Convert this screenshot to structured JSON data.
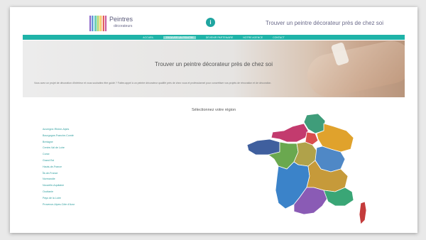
{
  "header": {
    "logo_title": "Peintres",
    "logo_subtitle": "décorateurs",
    "info_label": "i",
    "tagline": "Trouver un peintre décorateur près de chez soi",
    "logo_colors": [
      "#8a63c7",
      "#5c8fd6",
      "#3fb4c6",
      "#4ec59a",
      "#a3cf5b",
      "#f0c84b",
      "#f19a45",
      "#e2575b",
      "#c8589f"
    ]
  },
  "nav": {
    "items": [
      "Accueil",
      "Trouver un peintre",
      "Devenir partenaire",
      "Notre agence",
      "Contact"
    ],
    "active_index": 1,
    "accent": "#1fb3a8"
  },
  "hero": {
    "title": "Trouver un peintre décorateur près de chez soi",
    "text": "Vous avez un projet de décoration d'intérieur et vous souhaitez être guidé ? Faites appel à un peintre décorateur qualifié près de chez vous et professionnel pour concrétiser vos projets de rénovation et de décoration."
  },
  "regions_section": {
    "title": "Sélectionnez votre région",
    "items": [
      "Auvergne-Rhône-Alpes",
      "Bourgogne-Franche-Comté",
      "Bretagne",
      "Centre-Val de Loire",
      "Corse",
      "Grand Est",
      "Hauts-de-France",
      "Île-de-France",
      "Normandie",
      "Nouvelle-Aquitaine",
      "Occitanie",
      "Pays de la Loire",
      "Provence-Alpes-Côte d'Azur"
    ]
  },
  "map": {
    "colors": {
      "hauts_de_france": "#3f9d7a",
      "normandie": "#c33b6e",
      "ile_de_france": "#d94e4e",
      "grand_est": "#e0a22c",
      "bretagne": "#3f5f9e",
      "pays_de_la_loire": "#6aa84f",
      "centre_val_de_loire": "#b0a24a",
      "bourgogne_franche_comte": "#4f88c6",
      "nouvelle_aquitaine": "#3b83c9",
      "auvergne_rhone_alpes": "#c69a3a",
      "occitanie": "#8a5bb5",
      "paca": "#3aa676",
      "corse": "#c43b3b"
    }
  }
}
